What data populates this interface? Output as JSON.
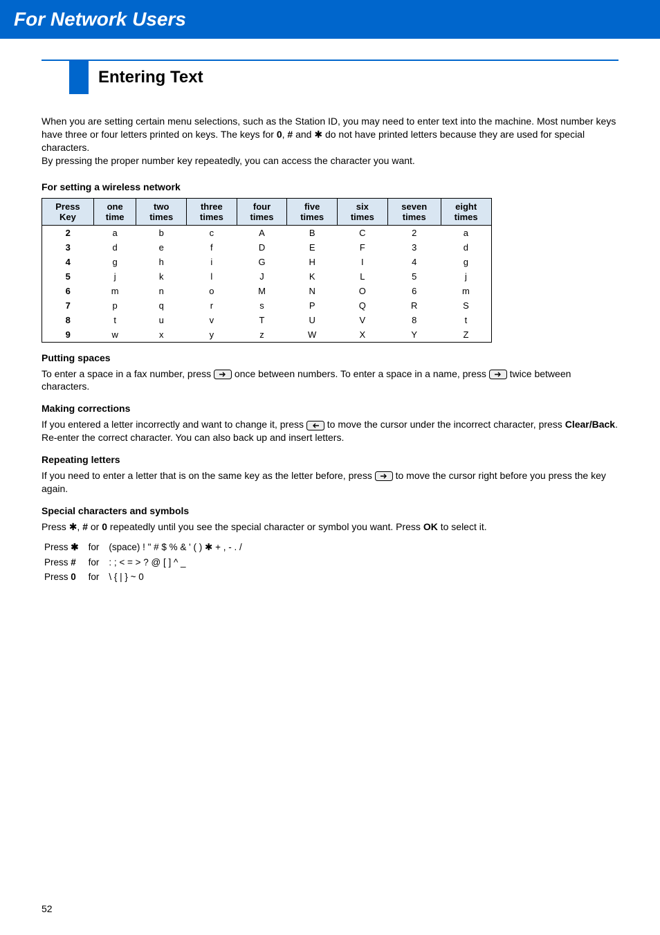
{
  "header": {
    "title": "For Network Users"
  },
  "section": {
    "title": "Entering Text"
  },
  "intro": {
    "p1a": "When you are setting certain menu selections, such as the Station ID, you may need to enter text into the machine. Most number keys have three or four letters printed on keys. The keys for ",
    "p1_key0": "0",
    "p1_sep1": ", ",
    "p1_keyhash": "#",
    "p1_and": " and ",
    "p1_star": "✱",
    "p1b": " do not have printed letters because they are used for special characters.",
    "p2": "By pressing the proper number key repeatedly, you can access the character you want."
  },
  "wireless_heading": "For setting a wireless network",
  "chart_data": {
    "type": "table",
    "headers": [
      "Press Key",
      "one time",
      "two times",
      "three times",
      "four times",
      "five times",
      "six times",
      "seven times",
      "eight times"
    ],
    "rows": [
      [
        "2",
        "a",
        "b",
        "c",
        "A",
        "B",
        "C",
        "2",
        "a"
      ],
      [
        "3",
        "d",
        "e",
        "f",
        "D",
        "E",
        "F",
        "3",
        "d"
      ],
      [
        "4",
        "g",
        "h",
        "i",
        "G",
        "H",
        "I",
        "4",
        "g"
      ],
      [
        "5",
        "j",
        "k",
        "l",
        "J",
        "K",
        "L",
        "5",
        "j"
      ],
      [
        "6",
        "m",
        "n",
        "o",
        "M",
        "N",
        "O",
        "6",
        "m"
      ],
      [
        "7",
        "p",
        "q",
        "r",
        "s",
        "P",
        "Q",
        "R",
        "S"
      ],
      [
        "8",
        "t",
        "u",
        "v",
        "T",
        "U",
        "V",
        "8",
        "t"
      ],
      [
        "9",
        "w",
        "x",
        "y",
        "z",
        "W",
        "X",
        "Y",
        "Z"
      ]
    ]
  },
  "putting_spaces": {
    "heading": "Putting spaces",
    "a": "To enter a space in a fax number, press ",
    "b": " once between numbers. To enter a space in a name, press ",
    "c": " twice between characters."
  },
  "making_corrections": {
    "heading": "Making corrections",
    "a": "If you entered a letter incorrectly and want to change it, press ",
    "b": " to move the cursor under the incorrect character, press ",
    "clear": "Clear/Back",
    "c": ". Re-enter the correct character. You can also back up and insert letters."
  },
  "repeating": {
    "heading": "Repeating letters",
    "a": "If you need to enter a letter that is on the same key as the letter before, press ",
    "b": " to move the cursor right before you press the key again."
  },
  "special": {
    "heading": "Special characters and symbols",
    "a": "Press ",
    "star": "✱",
    "sep1": ", ",
    "hash": "#",
    "or": " or ",
    "zero": "0",
    "b": " repeatedly until you see the special character or symbol you want. Press ",
    "ok": "OK",
    "c": " to select it.",
    "rows": [
      {
        "press": "Press ",
        "key": "✱",
        "for": "for",
        "chars": "(space) ! \" # $ % & ' ( ) ✱ + , - . /"
      },
      {
        "press": "Press ",
        "key": "#",
        "for": "for",
        "chars": ": ; < = > ? @ [ ] ^ _"
      },
      {
        "press": "Press ",
        "key": "0",
        "for": "for",
        "chars": "\\ { | } ~ 0"
      }
    ]
  },
  "page_number": "52",
  "icons": {
    "right_arrow": "right-arrow-key-icon",
    "left_arrow": "left-arrow-key-icon"
  }
}
